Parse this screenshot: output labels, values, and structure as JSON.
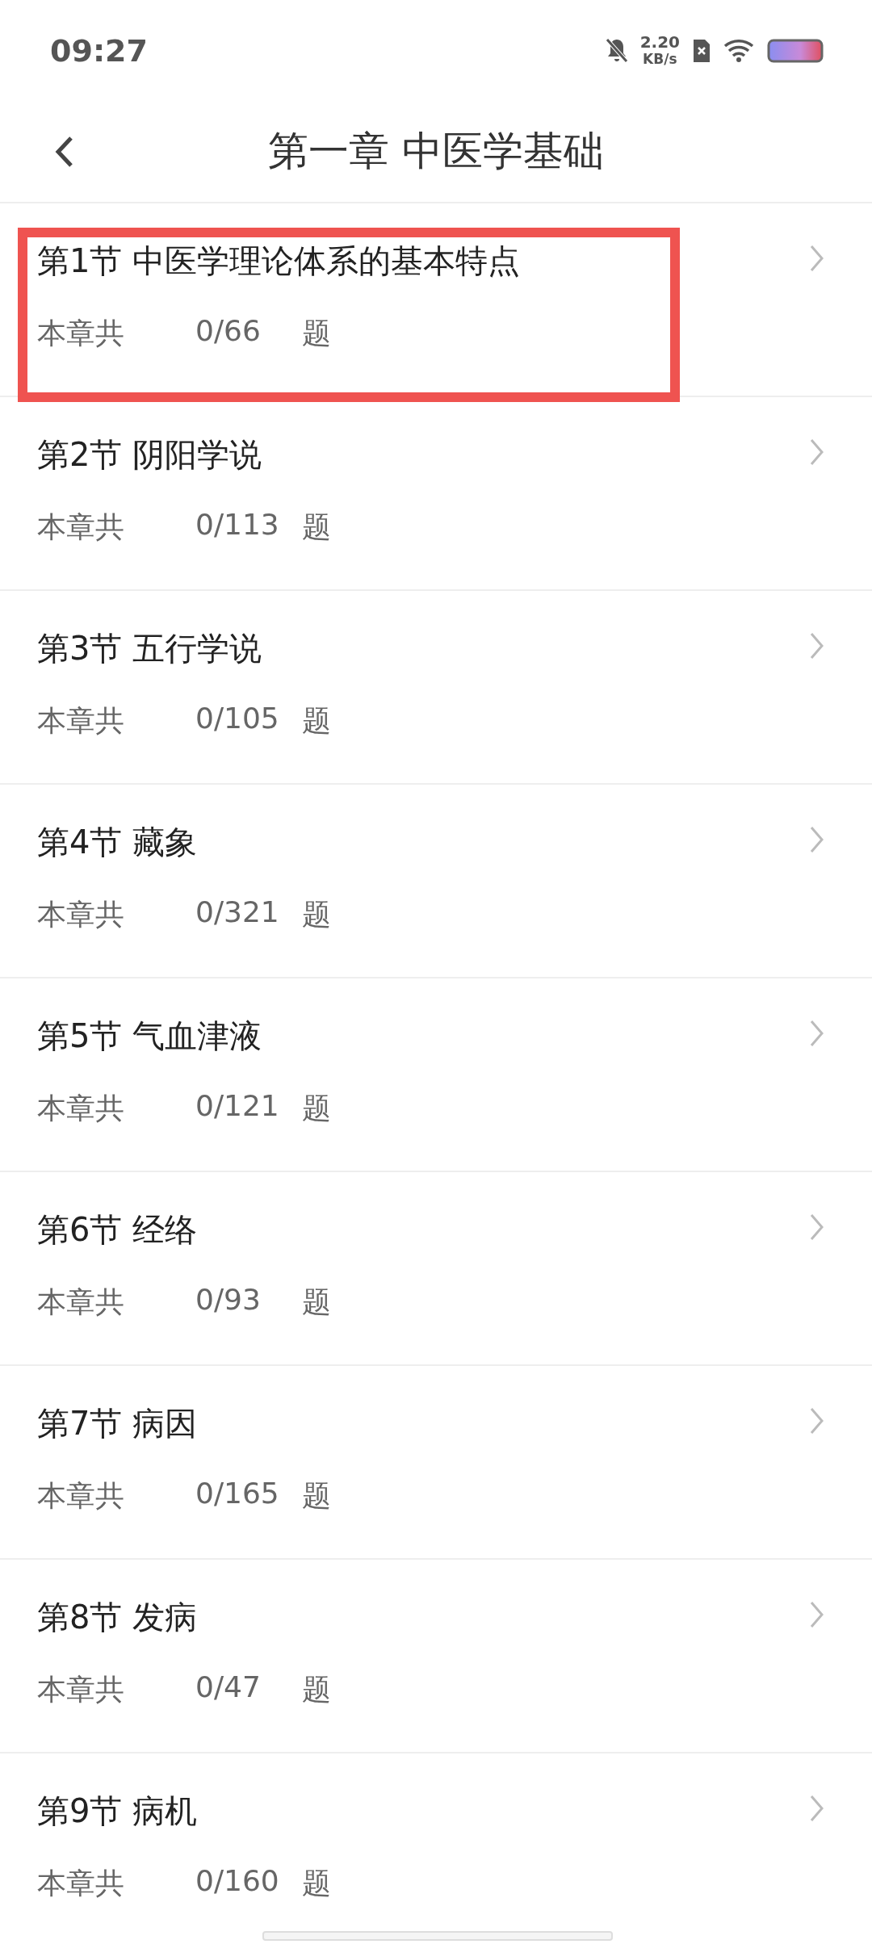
{
  "status_bar": {
    "time": "09:27",
    "speed_value": "2.20",
    "speed_unit": "KB/s"
  },
  "header": {
    "title": "第一章 中医学基础"
  },
  "sections": [
    {
      "title": "第1节 中医学理论体系的基本特点",
      "label": "本章共",
      "count": "0/66",
      "unit": "题",
      "highlighted": true
    },
    {
      "title": "第2节 阴阳学说",
      "label": "本章共",
      "count": "0/113",
      "unit": "题",
      "highlighted": false
    },
    {
      "title": "第3节 五行学说",
      "label": "本章共",
      "count": "0/105",
      "unit": "题",
      "highlighted": false
    },
    {
      "title": "第4节 藏象",
      "label": "本章共",
      "count": "0/321",
      "unit": "题",
      "highlighted": false
    },
    {
      "title": "第5节 气血津液",
      "label": "本章共",
      "count": "0/121",
      "unit": "题",
      "highlighted": false
    },
    {
      "title": "第6节 经络",
      "label": "本章共",
      "count": "0/93",
      "unit": "题",
      "highlighted": false
    },
    {
      "title": "第7节 病因",
      "label": "本章共",
      "count": "0/165",
      "unit": "题",
      "highlighted": false
    },
    {
      "title": "第8节 发病",
      "label": "本章共",
      "count": "0/47",
      "unit": "题",
      "highlighted": false
    },
    {
      "title": "第9节 病机",
      "label": "本章共",
      "count": "0/160",
      "unit": "题",
      "highlighted": false
    }
  ]
}
